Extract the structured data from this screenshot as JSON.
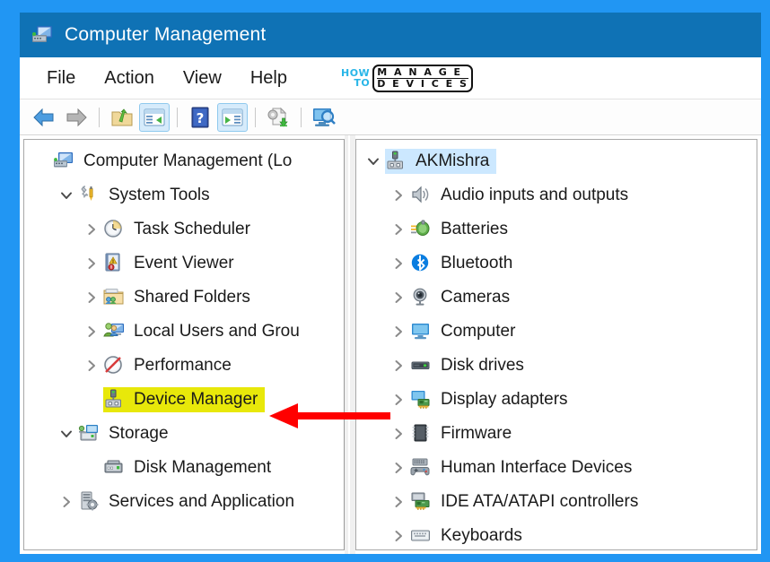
{
  "window": {
    "title": "Computer Management",
    "icon": "computer-management-icon"
  },
  "menubar": {
    "items": [
      {
        "label": "File"
      },
      {
        "label": "Action"
      },
      {
        "label": "View"
      },
      {
        "label": "Help"
      }
    ],
    "brand": {
      "how": "HOW",
      "to": "TO",
      "line1": "M A N A G E",
      "line2": "D E V I C E S",
      "accent": "#29B6E8"
    }
  },
  "toolbar": {
    "buttons": [
      {
        "name": "back-button",
        "icon": "back-arrow-icon",
        "active": false
      },
      {
        "name": "forward-button",
        "icon": "forward-arrow-icon",
        "active": false
      },
      {
        "name": "separator-1",
        "icon": "separator",
        "active": false
      },
      {
        "name": "up-one-level-button",
        "icon": "folder-up-icon",
        "active": false
      },
      {
        "name": "show-hide-console-tree-button",
        "icon": "console-tree-icon",
        "active": true
      },
      {
        "name": "separator-2",
        "icon": "separator",
        "active": false
      },
      {
        "name": "help-button",
        "icon": "question-mark-icon",
        "active": false
      },
      {
        "name": "show-hide-action-pane-button",
        "icon": "action-pane-icon",
        "active": true
      },
      {
        "name": "separator-3",
        "icon": "separator",
        "active": false
      },
      {
        "name": "update-driver-button",
        "icon": "update-driver-icon",
        "active": false
      },
      {
        "name": "separator-4",
        "icon": "separator",
        "active": false
      },
      {
        "name": "scan-hardware-changes-button",
        "icon": "scan-monitor-icon",
        "active": false
      }
    ]
  },
  "left_tree": {
    "nodes": [
      {
        "label": "Computer Management (Lo",
        "icon": "computer-management-icon",
        "chevron": "none",
        "indent": 0,
        "highlight": "none"
      },
      {
        "label": "System Tools",
        "icon": "system-tools-icon",
        "chevron": "down",
        "indent": 1,
        "highlight": "none"
      },
      {
        "label": "Task Scheduler",
        "icon": "task-scheduler-icon",
        "chevron": "right",
        "indent": 2,
        "highlight": "none"
      },
      {
        "label": "Event Viewer",
        "icon": "event-viewer-icon",
        "chevron": "right",
        "indent": 2,
        "highlight": "none"
      },
      {
        "label": "Shared Folders",
        "icon": "shared-folders-icon",
        "chevron": "right",
        "indent": 2,
        "highlight": "none"
      },
      {
        "label": "Local Users and Grou",
        "icon": "local-users-groups-icon",
        "chevron": "right",
        "indent": 2,
        "highlight": "none"
      },
      {
        "label": "Performance",
        "icon": "performance-icon",
        "chevron": "right",
        "indent": 2,
        "highlight": "none"
      },
      {
        "label": "Device Manager",
        "icon": "device-manager-icon",
        "chevron": "none",
        "indent": 2,
        "highlight": "yellow"
      },
      {
        "label": "Storage",
        "icon": "storage-icon",
        "chevron": "down",
        "indent": 1,
        "highlight": "none"
      },
      {
        "label": "Disk Management",
        "icon": "disk-management-icon",
        "chevron": "none",
        "indent": 2,
        "highlight": "none"
      },
      {
        "label": "Services and Application",
        "icon": "services-apps-icon",
        "chevron": "right",
        "indent": 1,
        "highlight": "none"
      }
    ]
  },
  "right_tree": {
    "nodes": [
      {
        "label": "AKMishra",
        "icon": "computer-device-icon",
        "chevron": "down",
        "indent": 0,
        "highlight": "blue"
      },
      {
        "label": "Audio inputs and outputs",
        "icon": "audio-speaker-icon",
        "chevron": "right",
        "indent": 1,
        "highlight": "none"
      },
      {
        "label": "Batteries",
        "icon": "battery-icon",
        "chevron": "right",
        "indent": 1,
        "highlight": "none"
      },
      {
        "label": "Bluetooth",
        "icon": "bluetooth-icon",
        "chevron": "right",
        "indent": 1,
        "highlight": "none"
      },
      {
        "label": "Cameras",
        "icon": "camera-icon",
        "chevron": "right",
        "indent": 1,
        "highlight": "none"
      },
      {
        "label": "Computer",
        "icon": "monitor-icon",
        "chevron": "right",
        "indent": 1,
        "highlight": "none"
      },
      {
        "label": "Disk drives",
        "icon": "disk-drive-icon",
        "chevron": "right",
        "indent": 1,
        "highlight": "none"
      },
      {
        "label": "Display adapters",
        "icon": "display-adapter-icon",
        "chevron": "right",
        "indent": 1,
        "highlight": "none"
      },
      {
        "label": "Firmware",
        "icon": "firmware-chip-icon",
        "chevron": "right",
        "indent": 1,
        "highlight": "none"
      },
      {
        "label": "Human Interface Devices",
        "icon": "gamepad-icon",
        "chevron": "right",
        "indent": 1,
        "highlight": "none"
      },
      {
        "label": "IDE ATA/ATAPI controllers",
        "icon": "ide-controller-icon",
        "chevron": "right",
        "indent": 1,
        "highlight": "none"
      },
      {
        "label": "Keyboards",
        "icon": "keyboard-icon",
        "chevron": "right",
        "indent": 1,
        "highlight": "none"
      }
    ]
  },
  "annotation": {
    "arrow_color": "#FF0000",
    "arrow_points_to": "Device Manager",
    "highlight_color": "#E8E80A",
    "selection_color": "#CCE8FF"
  }
}
